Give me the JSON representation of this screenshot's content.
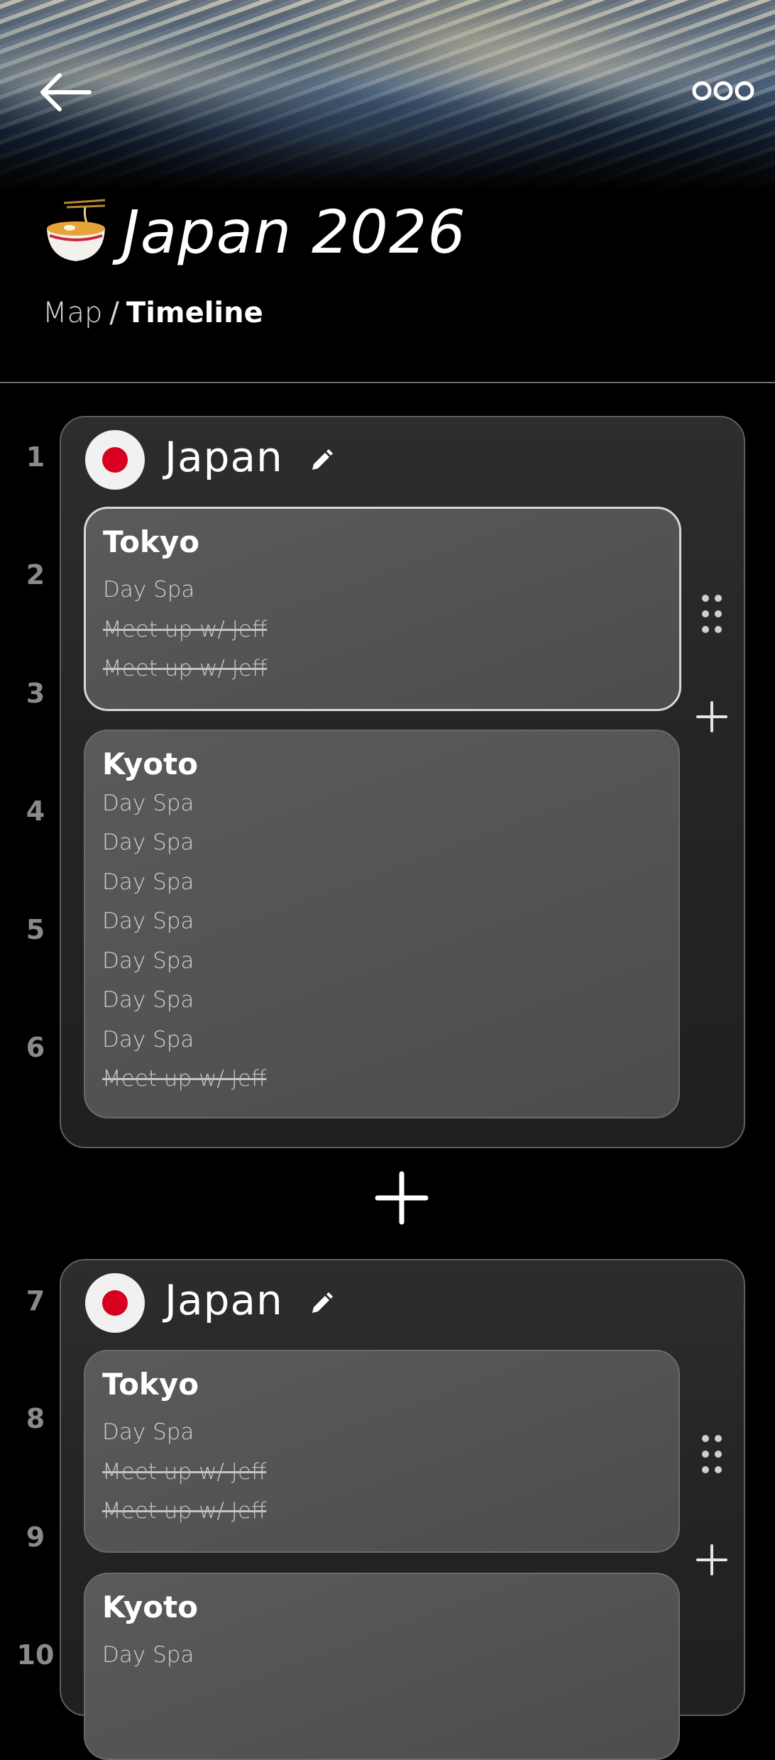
{
  "header": {
    "title": "Japan 2026",
    "title_icon": "ramen-bowl-icon",
    "back_icon": "back-arrow-icon",
    "more_icon": "more-icon"
  },
  "breadcrumb": {
    "map": "Map",
    "separator": "/",
    "current": "Timeline"
  },
  "row_numbers": [
    "1",
    "2",
    "3",
    "4",
    "5",
    "6",
    "7",
    "8",
    "9",
    "10"
  ],
  "groups": [
    {
      "name": "Japan",
      "flag": "japan-flag-icon",
      "cities": [
        {
          "name": "Tokyo",
          "activities": [
            {
              "text": "Day Spa",
              "done": false
            },
            {
              "text": "Meet up w/ Jeff",
              "done": true
            },
            {
              "text": "Meet up w/ Jeff",
              "done": true
            }
          ]
        },
        {
          "name": "Kyoto",
          "activities": [
            {
              "text": "Day Spa",
              "done": false
            },
            {
              "text": "Day Spa",
              "done": false
            },
            {
              "text": "Day Spa",
              "done": false
            },
            {
              "text": "Day Spa",
              "done": false
            },
            {
              "text": "Day Spa",
              "done": false
            },
            {
              "text": "Day Spa",
              "done": false
            },
            {
              "text": "Day Spa",
              "done": false
            },
            {
              "text": "Meet up w/ Jeff",
              "done": true
            }
          ]
        }
      ]
    },
    {
      "name": "Japan",
      "flag": "japan-flag-icon",
      "cities": [
        {
          "name": "Tokyo",
          "activities": [
            {
              "text": "Day Spa",
              "done": false
            },
            {
              "text": "Meet up w/ Jeff",
              "done": true
            },
            {
              "text": "Meet up w/ Jeff",
              "done": true
            }
          ]
        },
        {
          "name": "Kyoto",
          "activities": [
            {
              "text": "Day Spa",
              "done": false
            }
          ]
        }
      ]
    }
  ],
  "colors": {
    "background": "#000000",
    "group_bg": "#2a2a2a",
    "card_bg": "#555555",
    "flag_red": "#d7001f",
    "row_number": "#8a8a8a"
  }
}
